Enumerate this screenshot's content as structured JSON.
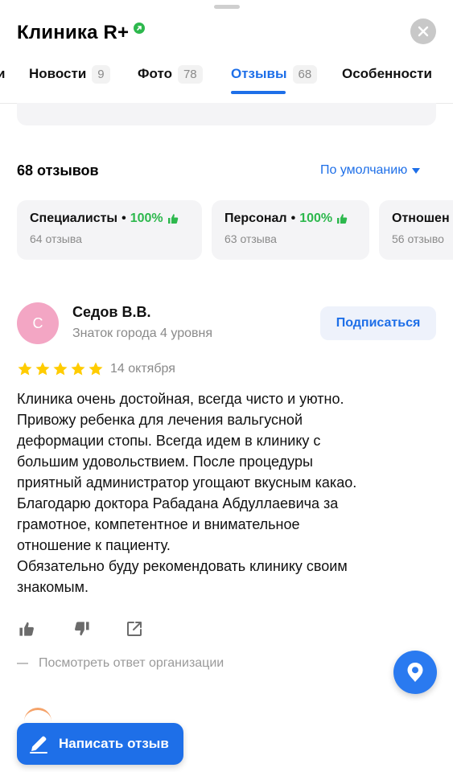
{
  "header": {
    "title": "Клиника R+",
    "close_icon": "close-icon",
    "verified_icon": "verified-badge-icon"
  },
  "tabs": [
    {
      "label": "и",
      "count": ""
    },
    {
      "label": "Новости",
      "count": "9"
    },
    {
      "label": "Фото",
      "count": "78"
    },
    {
      "label": "Отзывы",
      "count": "68",
      "active": true
    },
    {
      "label": "Особенности",
      "count": ""
    }
  ],
  "reviews": {
    "total_label": "68 отзывов",
    "sort_label": "По умолчанию"
  },
  "aspects": [
    {
      "name": "Специалисты",
      "percent": "100%",
      "sub": "64 отзыва"
    },
    {
      "name": "Персонал",
      "percent": "100%",
      "sub": "63 отзыва"
    },
    {
      "name": "Отношен",
      "percent": "",
      "sub": "56 отзыво"
    }
  ],
  "review": {
    "avatar_letter": "С",
    "author": "Седов В.В.",
    "level": "Знаток города 4 уровня",
    "subscribe_label": "Подписаться",
    "rating": 5,
    "date": "14 октября",
    "text_lines": [
      "Клиника очень достойная, всегда чисто и уютно.",
      "Привожу ребенка для лечения вальгусной",
      "деформации стопы. Всегда идем в клинику с",
      "большим удовольствием. После процедуры",
      "приятный администратор угощают вкусным какао.",
      "Благодарю доктора Рабадана Абдуллаевича за",
      "грамотное, компетентное и внимательное",
      "отношение к пациенту.",
      "Обязательно буду рекомендовать клинику своим",
      "знакомым."
    ],
    "org_reply_label": "Посмотреть ответ организации"
  },
  "colors": {
    "accent": "#1e6fe8",
    "positive": "#2db84d",
    "star": "#ffcc00",
    "avatar": "#f3a6c4"
  },
  "fab": {
    "icon": "map-pin-icon"
  },
  "write_review": {
    "label": "Написать отзыв",
    "icon": "pencil-icon"
  }
}
